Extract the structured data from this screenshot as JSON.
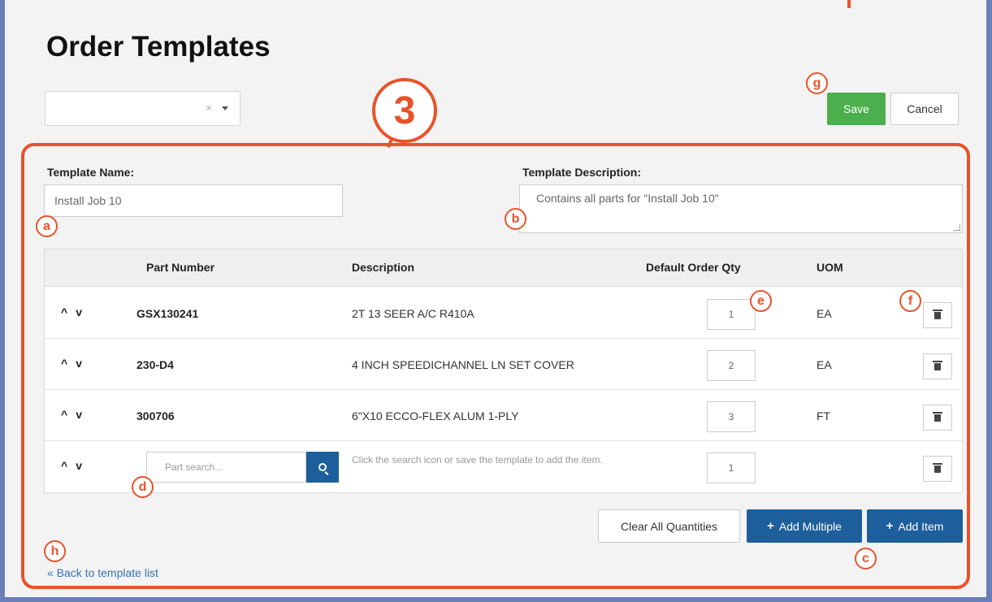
{
  "page": {
    "title": "Order Templates"
  },
  "template_select": {
    "value": "",
    "clear_glyph": "×"
  },
  "actions": {
    "save": "Save",
    "cancel": "Cancel"
  },
  "form": {
    "name_label": "Template Name:",
    "name_value": "Install Job 10",
    "desc_label": "Template Description:",
    "desc_value": "Contains all parts for \"Install Job 10\""
  },
  "table": {
    "headers": {
      "part": "Part Number",
      "desc": "Description",
      "qty": "Default Order Qty",
      "uom": "UOM"
    },
    "rows": [
      {
        "part": "GSX130241",
        "desc": "2T 13 SEER A/C R410A",
        "qty": "1",
        "uom": "EA"
      },
      {
        "part": "230-D4",
        "desc": "4 INCH SPEEDICHANNEL LN SET COVER",
        "qty": "2",
        "uom": "EA"
      },
      {
        "part": "300706",
        "desc": "6\"X10 ECCO-FLEX ALUM 1-PLY",
        "qty": "3",
        "uom": "FT"
      }
    ],
    "new_row": {
      "search_placeholder": "Part search...",
      "hint": "Click the search icon or save the template to add the item.",
      "qty": "1"
    },
    "arrow_up": "^",
    "arrow_down": "v"
  },
  "bottom_actions": {
    "clear": "Clear All Quantities",
    "add_multiple": "Add Multiple",
    "add_item": "Add Item",
    "plus": "+"
  },
  "back_link": "« Back to template list",
  "callouts": {
    "big": "3",
    "a": "a",
    "b": "b",
    "c": "c",
    "d": "d",
    "e": "e",
    "f": "f",
    "g": "g",
    "h": "h"
  },
  "colors": {
    "accent": "#e8532b",
    "primary": "#1d5f9c",
    "success": "#4cae4c",
    "frame": "#6a7fb8"
  },
  "icons": {
    "search": "search-icon",
    "trash": "trash-icon",
    "up": "chevron-up-icon",
    "down": "chevron-down-icon",
    "caret": "caret-down-icon"
  }
}
